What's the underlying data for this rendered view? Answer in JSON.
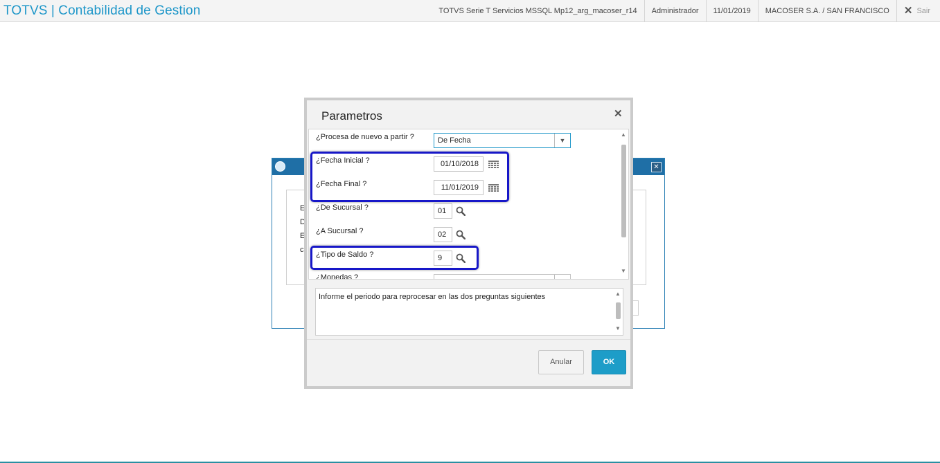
{
  "header": {
    "app_title": "TOTVS | Contabilidad de Gestion",
    "environment": "TOTVS Serie T Servicios MSSQL Mp12_arg_macoser_r14",
    "user": "Administrador",
    "date": "11/01/2019",
    "company": "MACOSER S.A. / SAN FRANCISCO",
    "logout_label": "Sair"
  },
  "background_window": {
    "letters": [
      "E",
      "D",
      "E",
      "c"
    ]
  },
  "dialog": {
    "title": "Parametros",
    "params": [
      {
        "label": "¿Procesa de nuevo a partir ?",
        "value": "De Fecha"
      },
      {
        "label": "¿Fecha Inicial ?",
        "value": "01/10/2018"
      },
      {
        "label": "¿Fecha Final ?",
        "value": "11/01/2019"
      },
      {
        "label": "¿De Sucursal ?",
        "value": "01"
      },
      {
        "label": "¿A Sucursal ?",
        "value": "02"
      },
      {
        "label": "¿Tipo de Saldo ?",
        "value": "9"
      },
      {
        "label": "¿Monedas ?"
      }
    ],
    "help_text": "Informe el periodo para reprocesar en las dos preguntas siguientes",
    "cancel_label": "Anular",
    "ok_label": "OK"
  },
  "colors": {
    "brand": "#1f97c9",
    "highlight": "#1717c8",
    "ok_button": "#1d9dc8"
  }
}
